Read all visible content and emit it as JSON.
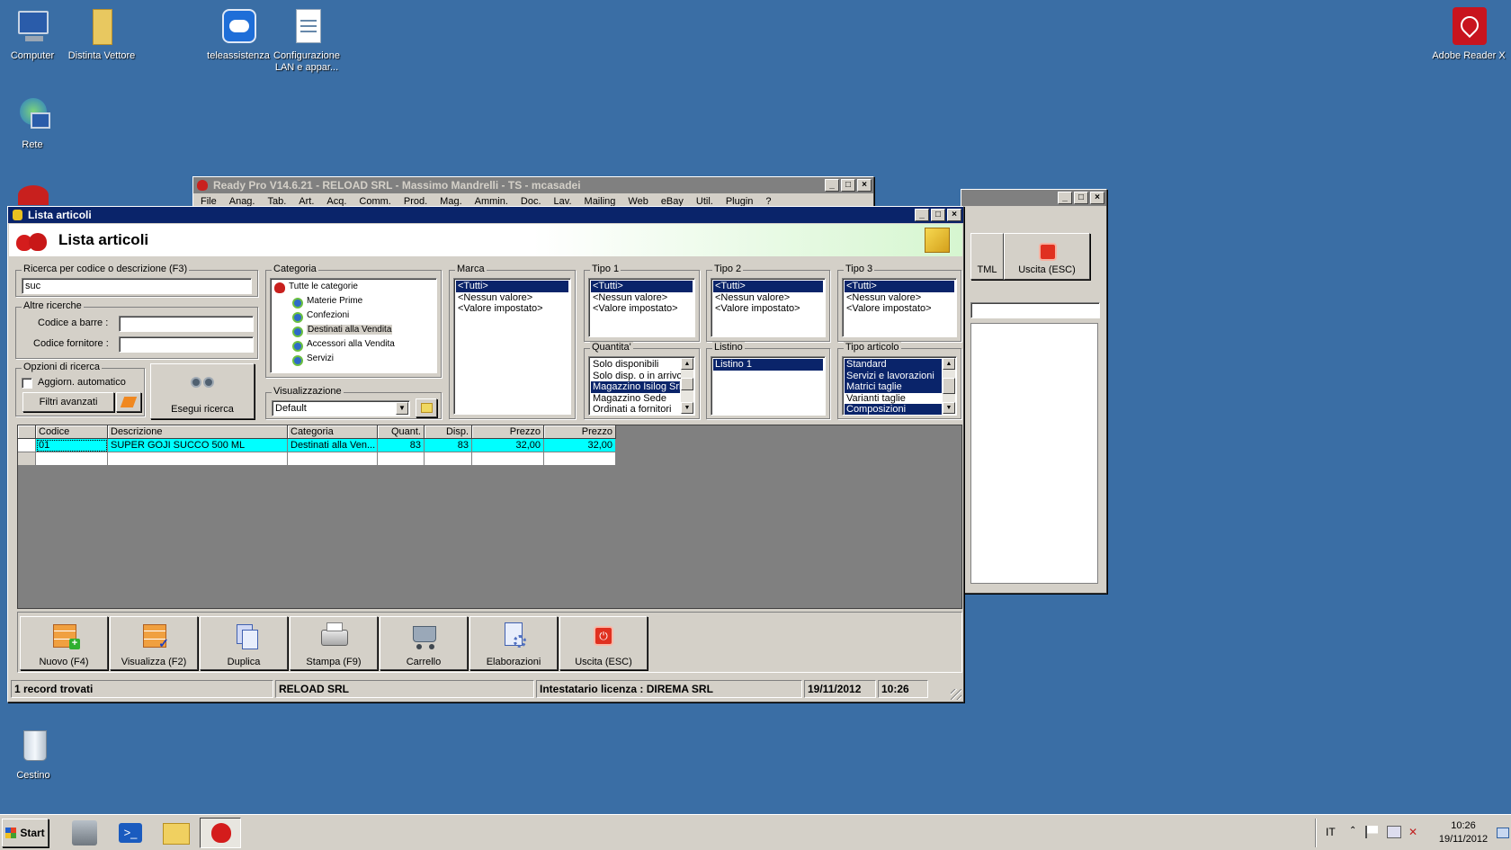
{
  "desktop": {
    "icons": [
      {
        "label": "Computer"
      },
      {
        "label": "Distinta Vettore"
      },
      {
        "label": "teleassistenza"
      },
      {
        "label": "Configurazione LAN e appar..."
      },
      {
        "label": "Rete"
      },
      {
        "label": "Adobe Reader X"
      },
      {
        "label": "Cestino"
      }
    ]
  },
  "back_window": {
    "title": "Ready Pro V14.6.21 - RELOAD SRL - Massimo Mandrelli - TS - mcasadei",
    "menu": [
      "File",
      "Anag.",
      "Tab.",
      "Art.",
      "Acq.",
      "Comm.",
      "Prod.",
      "Mag.",
      "Ammin.",
      "Doc.",
      "Lav.",
      "Mailing",
      "Web",
      "eBay",
      "Util.",
      "Plugin",
      "?"
    ]
  },
  "side_window": {
    "html_label": "TML",
    "exit_label": "Uscita (ESC)"
  },
  "main_window": {
    "title": "Lista articoli",
    "header": "Lista articoli",
    "search": {
      "label": "Ricerca per codice o descrizione (F3)",
      "value": "suc"
    },
    "other_searches": {
      "label": "Altre ricerche",
      "barcode_label": "Codice a barre :",
      "barcode_value": "",
      "supplier_label": "Codice fornitore :",
      "supplier_value": ""
    },
    "options": {
      "label": "Opzioni di ricerca",
      "auto_update": "Aggiorn. automatico",
      "auto_update_checked": false,
      "advanced_filters": "Filtri avanzati"
    },
    "run_search": "Esegui ricerca",
    "categoria": {
      "label": "Categoria",
      "items": [
        "Tutte le categorie",
        "Materie Prime",
        "Confezioni",
        "Destinati alla Vendita",
        "Accessori alla Vendita",
        "Servizi"
      ],
      "selected": "Destinati alla Vendita"
    },
    "visualizzazione": {
      "label": "Visualizzazione",
      "value": "Default"
    },
    "marca": {
      "label": "Marca",
      "items": [
        "<Tutti>",
        "<Nessun valore>",
        "<Valore impostato>"
      ]
    },
    "tipo1": {
      "label": "Tipo 1",
      "items": [
        "<Tutti>",
        "<Nessun valore>",
        "<Valore impostato>"
      ]
    },
    "tipo2": {
      "label": "Tipo 2",
      "items": [
        "<Tutti>",
        "<Nessun valore>",
        "<Valore impostato>"
      ]
    },
    "tipo3": {
      "label": "Tipo 3",
      "items": [
        "<Tutti>",
        "<Nessun valore>",
        "<Valore impostato>"
      ]
    },
    "quantita": {
      "label": "Quantita'",
      "items": [
        "Solo disponibili",
        "Solo disp. o in arrivo",
        "Magazzino Isilog Srl",
        "Magazzino Sede",
        "Ordinati a fornitori"
      ]
    },
    "listino": {
      "label": "Listino",
      "items": [
        "Listino 1"
      ]
    },
    "tipo_articolo": {
      "label": "Tipo articolo",
      "items": [
        "Standard",
        "Servizi e lavorazioni",
        "Matrici taglie",
        "Varianti taglie",
        "Composizioni"
      ]
    },
    "grid": {
      "columns": [
        "Codice",
        "Descrizione",
        "Categoria",
        "Quant.",
        "Disp.",
        "Prezzo",
        "Prezzo"
      ],
      "rows": [
        [
          "01",
          "SUPER GOJI SUCCO 500 ML",
          "Destinati alla Ven...",
          "83",
          "83",
          "32,00",
          "32,00"
        ]
      ]
    },
    "toolbar": {
      "new": "Nuovo (F4)",
      "view": "Visualizza (F2)",
      "duplicate": "Duplica",
      "print": "Stampa (F9)",
      "cart": "Carrello",
      "process": "Elaborazioni",
      "exit": "Uscita (ESC)"
    },
    "status": {
      "records": "1 record trovati",
      "company": "RELOAD SRL",
      "license": "Intestatario licenza : DIREMA SRL",
      "date": "19/11/2012",
      "time": "10:26"
    }
  },
  "taskbar": {
    "start": "Start",
    "lang": "IT",
    "clock_time": "10:26",
    "clock_date": "19/11/2012"
  }
}
